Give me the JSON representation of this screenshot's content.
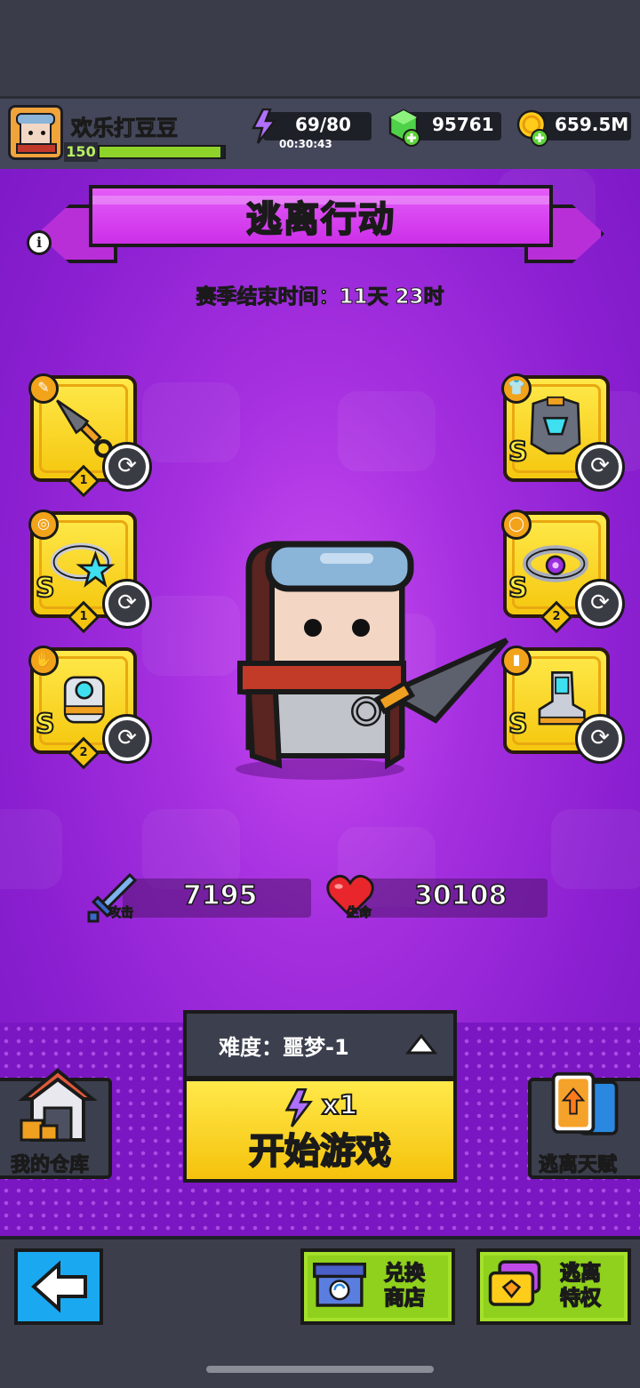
{
  "player": {
    "name": "欢乐打豆豆",
    "level": "150",
    "xp_fraction": 0.97
  },
  "resources": {
    "energy": {
      "value": "69/80",
      "timer": "00:30:43",
      "icon": "lightning-icon"
    },
    "gems": {
      "value": "95761",
      "icon": "green-gem-plus-icon"
    },
    "coins": {
      "value": "659.5M",
      "icon": "gold-coin-plus-icon"
    }
  },
  "header": {
    "title": "逃离行动",
    "info_icon": "info-icon"
  },
  "season": {
    "text": "赛季结束时间：11天 23时"
  },
  "equipment": {
    "left": [
      {
        "slot": "weapon",
        "icon": "kunai-icon",
        "grade": "",
        "level": "1"
      },
      {
        "slot": "necklace",
        "icon": "star-ring-icon",
        "grade": "S",
        "level": "1"
      },
      {
        "slot": "gloves",
        "icon": "gauntlet-icon",
        "grade": "S",
        "level": "2"
      }
    ],
    "right": [
      {
        "slot": "armor",
        "icon": "mech-armor-icon",
        "grade": "S",
        "level": ""
      },
      {
        "slot": "ring",
        "icon": "gem-ring-icon",
        "grade": "S",
        "level": "2"
      },
      {
        "slot": "boots",
        "icon": "mech-boot-icon",
        "grade": "S",
        "level": ""
      }
    ]
  },
  "stats": {
    "attack": {
      "label": "攻击",
      "value": "7195",
      "icon": "sword-icon"
    },
    "hp": {
      "label": "生命",
      "value": "30108",
      "icon": "heart-icon"
    }
  },
  "difficulty": {
    "text": "难度：噩梦-1"
  },
  "start": {
    "cost": "x1",
    "label": "开始游戏"
  },
  "side_buttons": {
    "warehouse": "我的仓库",
    "talent": "逃离天赋"
  },
  "bottom": {
    "shop": [
      "兑换",
      "商店"
    ],
    "privilege": [
      "逃离",
      "特权"
    ]
  },
  "colors": {
    "accent": "#f5c20c",
    "purple": "#a42fdf",
    "green": "#8fd11c",
    "blue": "#1aa8f0"
  }
}
